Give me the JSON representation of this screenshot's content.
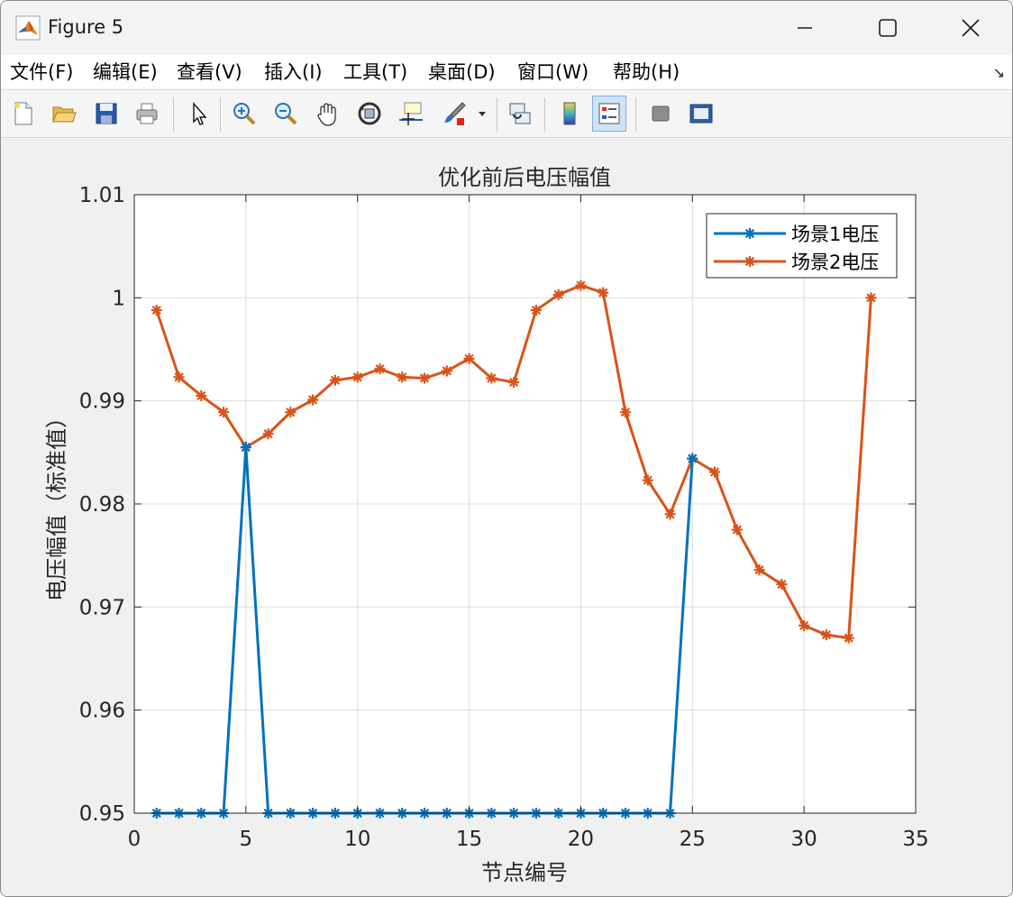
{
  "window": {
    "title": "Figure 5"
  },
  "menu": [
    "文件(F)",
    "编辑(E)",
    "查看(V)",
    "插入(I)",
    "工具(T)",
    "桌面(D)",
    "窗口(W)",
    "帮助(H)"
  ],
  "toolbar": {
    "icons": [
      "new-file-icon",
      "open-folder-icon",
      "save-icon",
      "print-icon",
      "pointer-icon",
      "zoom-in-icon",
      "zoom-out-icon",
      "pan-icon",
      "rotate-3d-icon",
      "data-cursor-icon",
      "brush-icon",
      "brush-dropdown-icon",
      "link-plot-icon",
      "colorbar-icon",
      "legend-icon",
      "hide-plot-tools-icon",
      "show-plot-tools-icon"
    ]
  },
  "chart_data": {
    "type": "line",
    "title": "优化前后电压幅值",
    "xlabel": "节点编号",
    "ylabel": "电压幅值（标准值）",
    "xlim": [
      0,
      35
    ],
    "ylim": [
      0.95,
      1.01
    ],
    "xticks": [
      "0",
      "5",
      "10",
      "15",
      "20",
      "25",
      "30",
      "35"
    ],
    "yticks": [
      "0.95",
      "0.96",
      "0.97",
      "0.98",
      "0.99",
      "1",
      "1.01"
    ],
    "grid": true,
    "legend_position": "top-right",
    "x": [
      1,
      2,
      3,
      4,
      5,
      6,
      7,
      8,
      9,
      10,
      11,
      12,
      13,
      14,
      15,
      16,
      17,
      18,
      19,
      20,
      21,
      22,
      23,
      24,
      25,
      26,
      27,
      28,
      29,
      30,
      31,
      32,
      33
    ],
    "series": [
      {
        "name": "场景1电压",
        "color": "#0072bd",
        "marker": "asterisk",
        "values": [
          0.95,
          0.95,
          0.95,
          0.95,
          0.9855,
          0.95,
          0.95,
          0.95,
          0.95,
          0.95,
          0.95,
          0.95,
          0.95,
          0.95,
          0.95,
          0.95,
          0.95,
          0.95,
          0.95,
          0.95,
          0.95,
          0.95,
          0.95,
          0.95,
          0.9844
        ]
      },
      {
        "name": "场景2电压",
        "color": "#d95319",
        "marker": "asterisk",
        "values": [
          0.9988,
          0.9923,
          0.9905,
          0.9889,
          0.9855,
          0.9868,
          0.9889,
          0.9901,
          0.992,
          0.9923,
          0.9931,
          0.9923,
          0.9922,
          0.9929,
          0.9941,
          0.9922,
          0.9918,
          0.9988,
          1.0003,
          1.0012,
          1.0005,
          0.9889,
          0.9823,
          0.979,
          0.9844,
          0.9831,
          0.9775,
          0.9736,
          0.9722,
          0.9682,
          0.9673,
          0.967,
          1.0
        ]
      }
    ]
  }
}
